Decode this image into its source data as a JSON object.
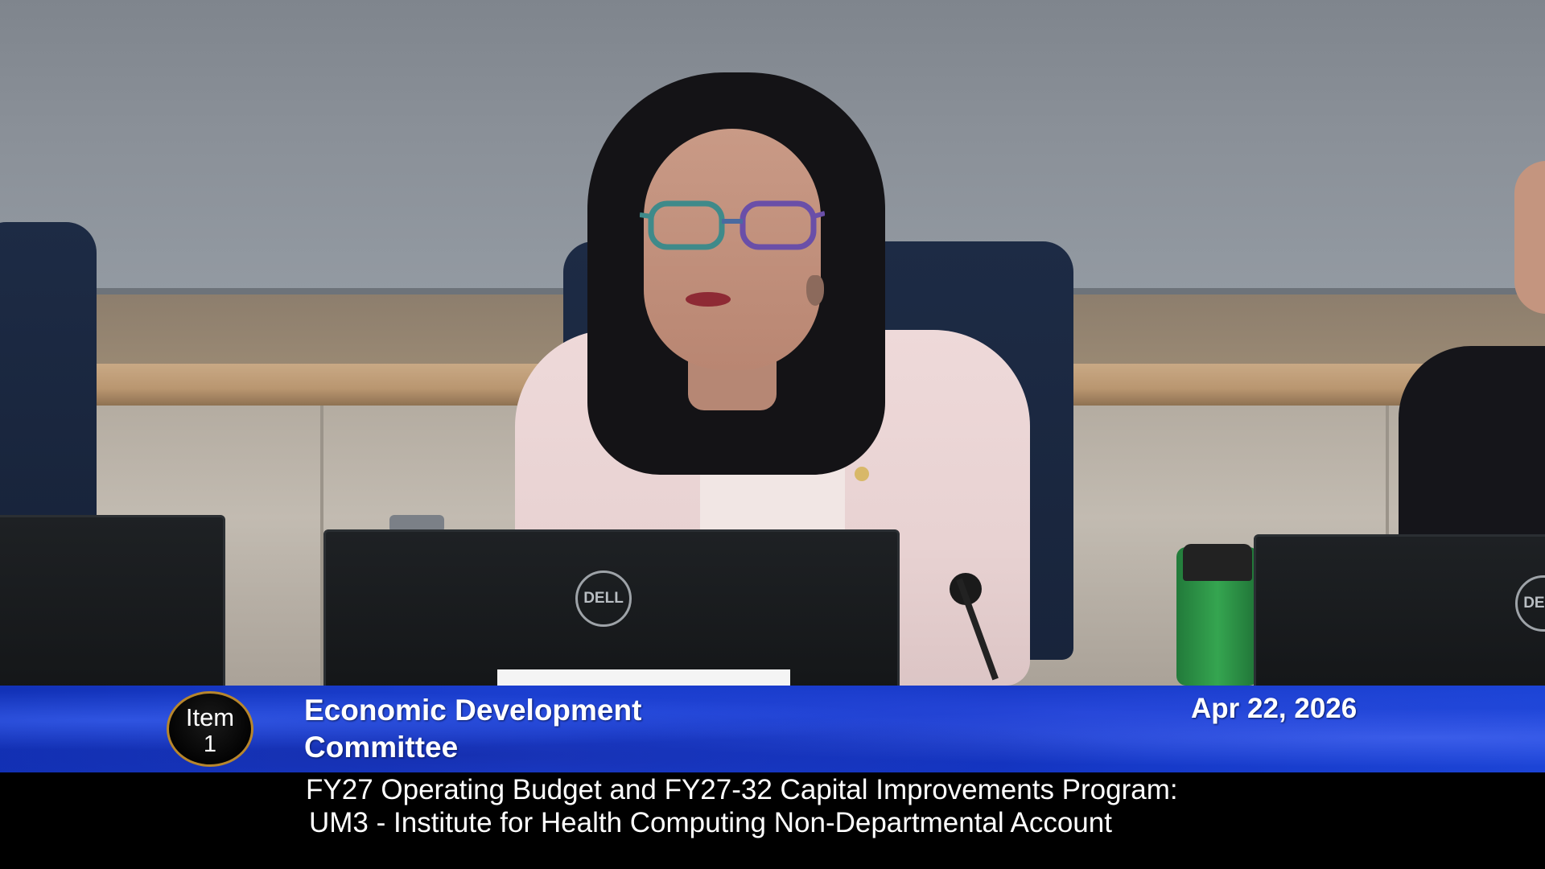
{
  "lower_third": {
    "item_label": "Item",
    "item_number": "1",
    "committee_line_1": "Economic Development",
    "committee_line_2": "Committee",
    "date": "Apr 22, 2026"
  },
  "caption": {
    "line_1": "FY27 Operating Budget and FY27-32 Capital Improvements Program:",
    "line_2": "UM3 - Institute for Health Computing Non-Departmental Account"
  },
  "scene": {
    "monitor_logo": "DELL",
    "colors": {
      "banner_blue": "#1b3fd0",
      "badge_ring": "#b7862c",
      "caption_bg": "#000000",
      "jacket_pink": "#eed9d9",
      "bottle_green": "#2f9a4a"
    }
  }
}
